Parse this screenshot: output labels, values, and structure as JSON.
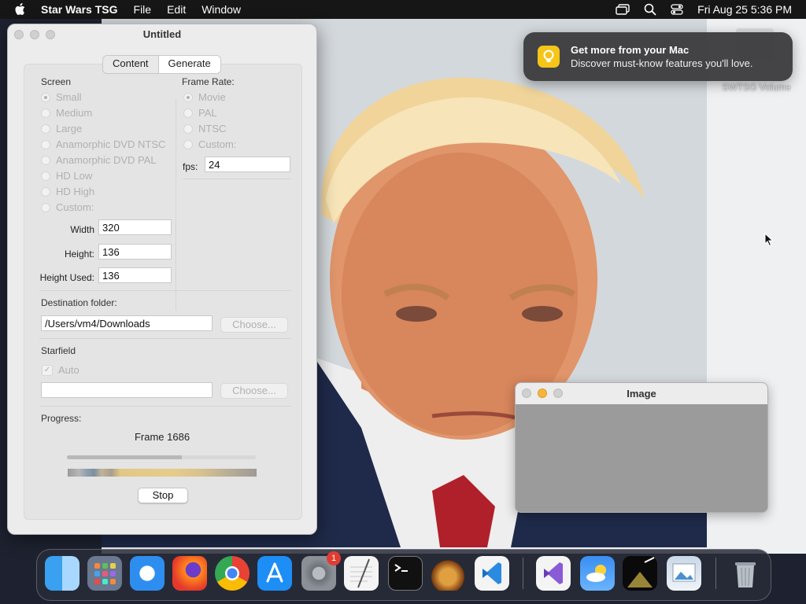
{
  "menubar": {
    "app_name": "Star Wars TSG",
    "items": [
      "File",
      "Edit",
      "Window"
    ],
    "clock": "Fri Aug 25  5:36 PM"
  },
  "desktop": {
    "volume_label": "SWTSG Volume"
  },
  "notification": {
    "title": "Get more from your Mac",
    "body": "Discover must-know features you'll love.",
    "icon": "lightbulb-icon",
    "accent": "#f5c518"
  },
  "main_window": {
    "title": "Untitled",
    "tabs": [
      {
        "label": "Content",
        "selected": false
      },
      {
        "label": "Generate",
        "selected": true
      }
    ],
    "screen": {
      "label": "Screen",
      "options": [
        "Small",
        "Medium",
        "Large",
        "Anamorphic DVD NTSC",
        "Anamorphic DVD PAL",
        "HD Low",
        "HD High",
        "Custom:"
      ],
      "selected": "Small",
      "width_label": "Width",
      "width_value": "320",
      "height_label": "Height:",
      "height_value": "136",
      "height_used_label": "Height Used:",
      "height_used_value": "136"
    },
    "frame_rate": {
      "label": "Frame Rate:",
      "options": [
        "Movie",
        "PAL",
        "NTSC",
        "Custom:"
      ],
      "selected": "Movie",
      "fps_label": "fps:",
      "fps_value": "24"
    },
    "destination": {
      "label": "Destination folder:",
      "path": "/Users/vm4/Downloads",
      "choose_label": "Choose..."
    },
    "starfield": {
      "label": "Starfield",
      "auto_label": "Auto",
      "auto_checked": true,
      "path": "",
      "choose_label": "Choose..."
    },
    "progress": {
      "label": "Progress:",
      "status": "Frame 1686",
      "fraction": 0.61,
      "stop_label": "Stop"
    }
  },
  "image_window": {
    "title": "Image"
  },
  "dock": {
    "apps": [
      "Finder",
      "Launchpad",
      "Safari",
      "Firefox",
      "Chrome",
      "App Store",
      "System Settings",
      "TextEdit",
      "Terminal",
      "GarageBand",
      "Visual Studio Code",
      "Visual Studio",
      "Weather",
      "Star Wars TSG",
      "Preview",
      "Trash"
    ],
    "settings_badge": "1"
  }
}
